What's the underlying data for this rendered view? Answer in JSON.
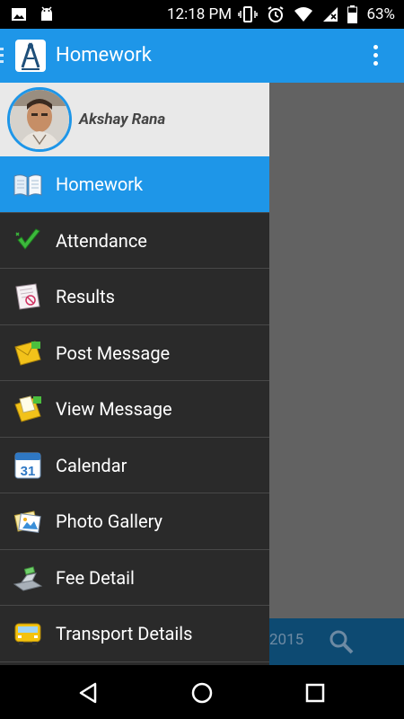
{
  "status_bar": {
    "time": "12:18 PM",
    "battery": "63%"
  },
  "app_bar": {
    "title": "Homework"
  },
  "drawer": {
    "user_name": "Akshay Rana",
    "items": [
      {
        "label": "Homework",
        "icon": "book-icon",
        "active": true
      },
      {
        "label": "Attendance",
        "icon": "checkmark-icon",
        "active": false
      },
      {
        "label": "Results",
        "icon": "results-icon",
        "active": false
      },
      {
        "label": "Post Message",
        "icon": "envelope-icon",
        "active": false
      },
      {
        "label": "View Message",
        "icon": "open-envelope-icon",
        "active": false
      },
      {
        "label": "Calendar",
        "icon": "calendar-icon",
        "active": false
      },
      {
        "label": "Photo Gallery",
        "icon": "photo-gallery-icon",
        "active": false
      },
      {
        "label": "Fee Detail",
        "icon": "cash-register-icon",
        "active": false
      },
      {
        "label": "Transport Details",
        "icon": "bus-icon",
        "active": false
      }
    ],
    "calendar_day": "31"
  },
  "background": {
    "year_fragment": "2015"
  },
  "colors": {
    "accent": "#1e96e8",
    "drawer_bg": "#2a2a2a",
    "profile_bg": "#e9e9e9"
  }
}
